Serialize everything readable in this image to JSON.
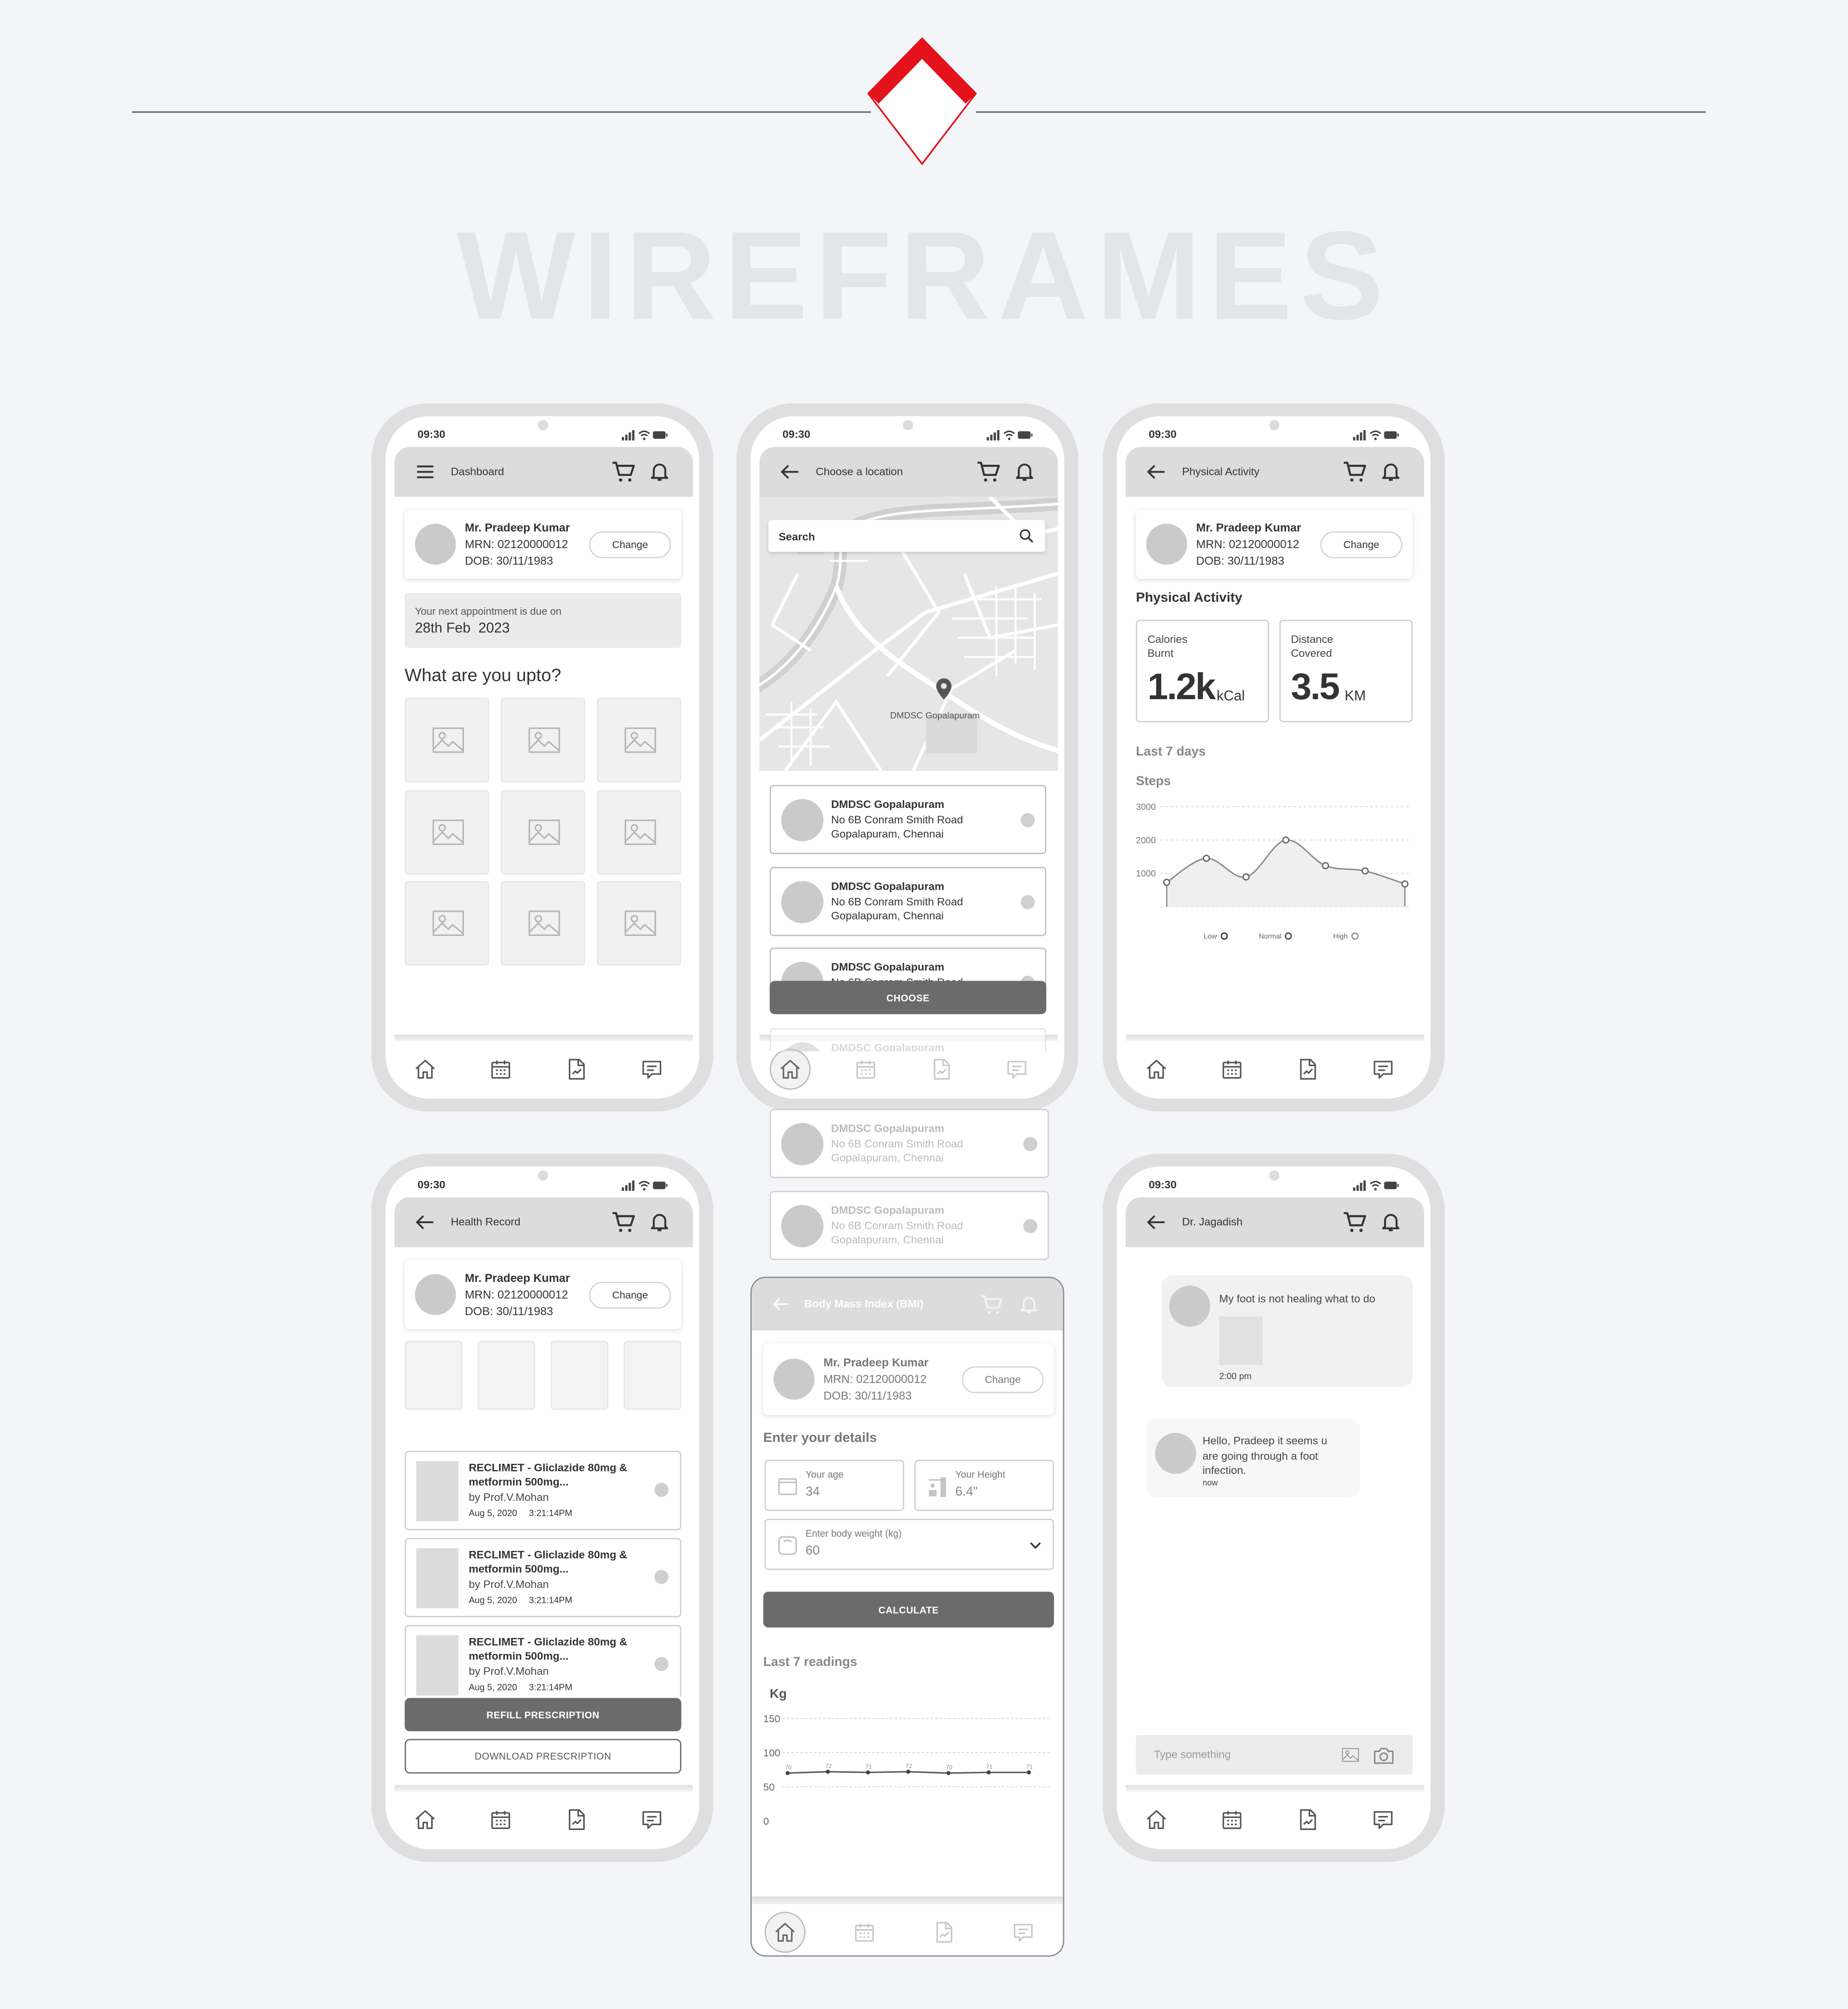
{
  "header": {
    "title": "WIREFRAMES",
    "accent_color": "#e3121b",
    "background": "#f4f5f9"
  },
  "status": {
    "time": "09:30"
  },
  "patient": {
    "name": "Mr. Pradeep Kumar",
    "mrn": "MRN: 02120000012",
    "dob": "DOB: 30/11/1983",
    "change_label": "Change"
  },
  "dashboard": {
    "title": "Dashboard",
    "appointment_label": "Your next appointment is due on",
    "appointment_date": "28th Feb  2023",
    "section_title": "What are you upto?"
  },
  "location": {
    "title": "Choose a location",
    "search_placeholder": "Search",
    "map_pin_label": "DMDSC Gopalapuram",
    "choose_label": "CHOOSE",
    "items": [
      {
        "name": "DMDSC Gopalapuram",
        "line1": "No 6B Conram Smith Road",
        "line2": "Gopalapuram, Chennai"
      },
      {
        "name": "DMDSC Gopalapuram",
        "line1": "No 6B Conram Smith Road",
        "line2": "Gopalapuram, Chennai"
      },
      {
        "name": "DMDSC Gopalapuram",
        "line1": "No 6B Conram Smith Road",
        "line2": "Gopalapuram, Chennai"
      },
      {
        "name": "DMDSC Gopalapuram",
        "line1": "No 6B Conram Smith Road",
        "line2": "Gopalapuram, Chennai"
      },
      {
        "name": "DMDSC Gopalapuram",
        "line1": "No 6B Conram Smith Road",
        "line2": "Gopalapuram, Chennai"
      },
      {
        "name": "DMDSC Gopalapuram",
        "line1": "No 6B Conram Smith Road",
        "line2": "Gopalapuram, Chennai"
      }
    ]
  },
  "activity": {
    "title": "Physical Activity",
    "section_title": "Physical Activity",
    "calories": {
      "label1": "Calories",
      "label2": "Burnt",
      "value": "1.2k",
      "unit": "kCal"
    },
    "distance": {
      "label1": "Distance",
      "label2": "Covered",
      "value": "3.5",
      "unit": "KM"
    },
    "period": "Last 7 days"
  },
  "health": {
    "title": "Health Record",
    "records": [
      {
        "title1": "RECLIMET - Gliclazide 80mg &",
        "title2": "metformin 500mg...",
        "doctor": "by Prof.V.Mohan",
        "date": "Aug 5, 2020",
        "time": "3:21:14PM"
      },
      {
        "title1": "RECLIMET - Gliclazide 80mg &",
        "title2": "metformin 500mg...",
        "doctor": "by Prof.V.Mohan",
        "date": "Aug 5, 2020",
        "time": "3:21:14PM"
      },
      {
        "title1": "RECLIMET - Gliclazide 80mg &",
        "title2": "metformin 500mg...",
        "doctor": "by Prof.V.Mohan",
        "date": "Aug 5, 2020",
        "time": "3:21:14PM"
      }
    ],
    "refill_label": "REFILL PRESCRIPTION",
    "download_label": "DOWNLOAD PRESCRIPTION"
  },
  "bmi": {
    "title": "Body Mass Index (BMI)",
    "section_title": "Enter your details",
    "age": {
      "label": "Your age",
      "value": "34"
    },
    "height": {
      "label": "Your Height",
      "value": "6.4\""
    },
    "weight": {
      "label": "Enter body weight (kg)",
      "value": "60"
    },
    "calculate_label": "CALCULATE",
    "readings_title": "Last 7 readings"
  },
  "chat": {
    "title": "Dr. Jagadish",
    "messages": [
      {
        "lines": [
          "My foot is not healing what to do"
        ],
        "time": "2:00 pm"
      },
      {
        "lines": [
          "Hello, Pradeep it seems u",
          "are going through a foot",
          "infection."
        ],
        "time": "now"
      }
    ],
    "input_placeholder": "Type something"
  },
  "chart_data": [
    {
      "type": "area",
      "title": "",
      "ylabel": "Steps",
      "ylim": [
        0,
        3000
      ],
      "yticks": [
        "1000",
        "2000",
        "3000"
      ],
      "grid": true,
      "series": [
        {
          "values": [
            730,
            1450,
            890,
            2000,
            1230,
            1070,
            680
          ]
        }
      ],
      "legend": [
        "Low",
        "Normal",
        "High"
      ],
      "legend_position": "bottom"
    },
    {
      "type": "line",
      "title": "",
      "ylabel": "Kg",
      "ylim": [
        0,
        150
      ],
      "yticks": [
        "0",
        "50",
        "100",
        "150"
      ],
      "grid": true,
      "series": [
        {
          "values": [
            70,
            72,
            71,
            72,
            70,
            71,
            71
          ]
        }
      ],
      "data_labels": true
    }
  ]
}
